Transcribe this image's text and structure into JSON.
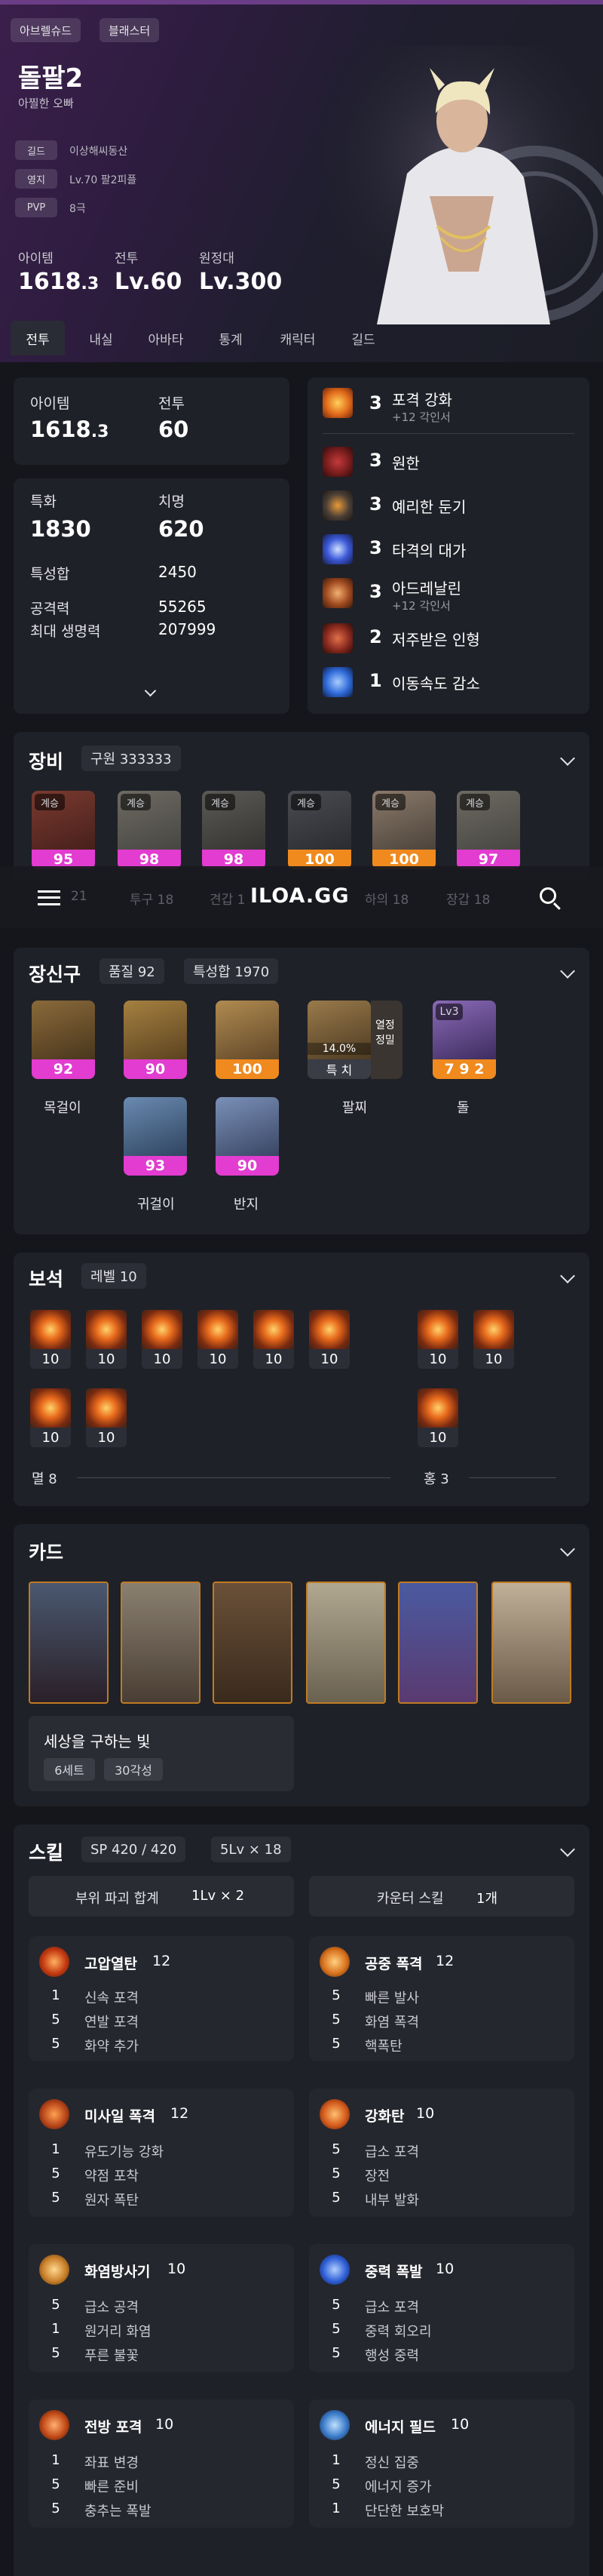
{
  "header": {
    "server": "아브렐슈드",
    "class": "블래스터",
    "name": "돌팔2",
    "title": "아찔한 오빠",
    "info": [
      {
        "label": "길드",
        "value": "이상해씨동산"
      },
      {
        "label": "영지",
        "value": "Lv.70 팔2피플"
      },
      {
        "label": "PVP",
        "value": "8극"
      }
    ],
    "stats": [
      {
        "label": "아이템",
        "main": "1618",
        "sub": ".3"
      },
      {
        "label": "전투",
        "main": "Lv.60",
        "sub": ""
      },
      {
        "label": "원정대",
        "main": "Lv.300",
        "sub": ""
      }
    ]
  },
  "tabs": [
    "전투",
    "내실",
    "아바타",
    "통계",
    "캐릭터",
    "길드"
  ],
  "summary": {
    "item_label": "아이템",
    "item_main": "1618",
    "item_sub": ".3",
    "battle_label": "전투",
    "battle_value": "60",
    "spec_label": "특화",
    "spec_value": "1830",
    "crit_label": "치명",
    "crit_value": "620",
    "total_label": "특성합",
    "total_value": "2450",
    "atk_label": "공격력",
    "atk_value": "55265",
    "hp_label": "최대 생명력",
    "hp_value": "207999"
  },
  "engravings": [
    {
      "level": "3",
      "name": "포격 강화",
      "sub": "+12 각인서",
      "color": "#e06a1a"
    },
    {
      "level": "3",
      "name": "원한",
      "sub": "",
      "color": "#7a1d1d"
    },
    {
      "level": "3",
      "name": "예리한 둔기",
      "sub": "",
      "color": "#4a3f36"
    },
    {
      "level": "3",
      "name": "타격의 대가",
      "sub": "",
      "color": "#3d5ad9"
    },
    {
      "level": "3",
      "name": "아드레날린",
      "sub": "+12 각인서",
      "color": "#a04a20"
    },
    {
      "level": "2",
      "name": "저주받은 인형",
      "sub": "",
      "color": "#8a2a1e"
    },
    {
      "level": "1",
      "name": "이동속도 감소",
      "sub": "",
      "color": "#2f6ad8"
    }
  ],
  "equipment": {
    "title": "장비",
    "badge": "구원 333333",
    "items": [
      {
        "tag": "계승",
        "quality": "95",
        "color": "#e23cd0"
      },
      {
        "tag": "계승",
        "quality": "98",
        "color": "#e23cd0"
      },
      {
        "tag": "계승",
        "quality": "98",
        "color": "#e23cd0"
      },
      {
        "tag": "계승",
        "quality": "100",
        "color": "#f08a1e"
      },
      {
        "tag": "계승",
        "quality": "100",
        "color": "#f08a1e"
      },
      {
        "tag": "계승",
        "quality": "97",
        "color": "#e23cd0"
      }
    ]
  },
  "overlay_nav": {
    "logo": "ILOA.GG",
    "items": [
      "21",
      "투구 18",
      "견갑 1",
      "하의 18",
      "장갑 18"
    ]
  },
  "accessories": {
    "title": "장신구",
    "quality_badge": "품질 92",
    "spec_badge": "특성합 1970",
    "necklace": {
      "quality": "92",
      "label": "목걸이"
    },
    "earrings": [
      {
        "quality": "90"
      },
      {
        "quality": "93"
      }
    ],
    "earring_label": "귀걸이",
    "rings": [
      {
        "quality": "100"
      },
      {
        "quality": "90"
      }
    ],
    "ring_label": "반지",
    "bracelet": {
      "percent": "14.0%",
      "text": "특 치",
      "side1": "열정",
      "side2": "정밀",
      "label": "팔찌"
    },
    "stone": {
      "lv": "Lv3",
      "value": "7 9 2",
      "label": "돌"
    }
  },
  "gems": {
    "title": "보석",
    "badge": "레벨 10",
    "left_levels": [
      "10",
      "10",
      "10",
      "10",
      "10",
      "10",
      "10",
      "10"
    ],
    "right_levels": [
      "10",
      "10",
      "10"
    ],
    "left_label": "멸 8",
    "right_label": "홍 3"
  },
  "cards": {
    "title": "카드",
    "set_name": "세상을 구하는 빛",
    "set_count": "6세트",
    "awaken": "30각성",
    "count": 7
  },
  "skills": {
    "title": "스킬",
    "sp_badge": "SP 420 / 420",
    "lv_badge": "5Lv × 18",
    "break_label": "부위 파괴 합계",
    "break_value": "1Lv × 2",
    "counter_label": "카운터 스킬",
    "counter_value": "1개",
    "list": [
      {
        "name": "고압열탄",
        "level": "12",
        "icon": "#c43a12",
        "tripods": [
          {
            "n": "1",
            "t": "신속 포격"
          },
          {
            "n": "5",
            "t": "연발 포격"
          },
          {
            "n": "5",
            "t": "화약 추가"
          }
        ]
      },
      {
        "name": "공중 폭격",
        "level": "12",
        "icon": "#d9731e",
        "tripods": [
          {
            "n": "5",
            "t": "빠른 발사"
          },
          {
            "n": "5",
            "t": "화염 폭격"
          },
          {
            "n": "5",
            "t": "핵폭탄"
          }
        ]
      },
      {
        "name": "미사일 폭격",
        "level": "12",
        "icon": "#b8461a",
        "tripods": [
          {
            "n": "1",
            "t": "유도기능 강화"
          },
          {
            "n": "5",
            "t": "약점 포착"
          },
          {
            "n": "5",
            "t": "원자 폭탄"
          }
        ]
      },
      {
        "name": "강화탄",
        "level": "10",
        "icon": "#d35a1c",
        "tripods": [
          {
            "n": "5",
            "t": "급소 포격"
          },
          {
            "n": "5",
            "t": "장전"
          },
          {
            "n": "5",
            "t": "내부 발화"
          }
        ]
      },
      {
        "name": "화염방사기",
        "level": "10",
        "icon": "#c9802a",
        "tripods": [
          {
            "n": "5",
            "t": "급소 공격"
          },
          {
            "n": "1",
            "t": "원거리 화염"
          },
          {
            "n": "5",
            "t": "푸른 불꽃"
          }
        ]
      },
      {
        "name": "중력 폭발",
        "level": "10",
        "icon": "#2f5fd6",
        "tripods": [
          {
            "n": "5",
            "t": "급소 포격"
          },
          {
            "n": "5",
            "t": "중력 회오리"
          },
          {
            "n": "5",
            "t": "행성 중력"
          }
        ]
      },
      {
        "name": "전방 포격",
        "level": "10",
        "icon": "#c24a18",
        "tripods": [
          {
            "n": "1",
            "t": "좌표 변경"
          },
          {
            "n": "5",
            "t": "빠른 준비"
          },
          {
            "n": "5",
            "t": "충추는 폭발"
          }
        ]
      },
      {
        "name": "에너지 필드",
        "level": "10",
        "icon": "#3b7bc9",
        "tripods": [
          {
            "n": "1",
            "t": "정신 집중"
          },
          {
            "n": "5",
            "t": "에너지 증가"
          },
          {
            "n": "1",
            "t": "단단한 보호막"
          }
        ]
      }
    ]
  }
}
